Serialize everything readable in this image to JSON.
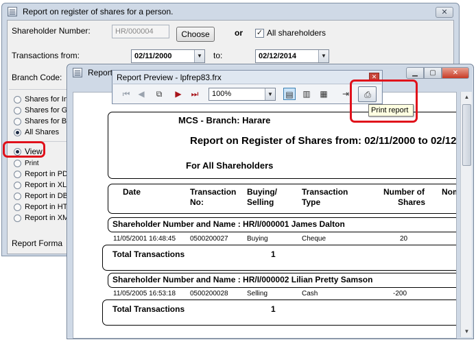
{
  "main_window": {
    "title": "Report on register of shares for a person.",
    "close_glyph": "✕",
    "shareholder_number_label": "Shareholder Number:",
    "shareholder_number_value": "HR/000004",
    "choose_label": "Choose",
    "or_label": "or",
    "all_shareholders_label": "All shareholders",
    "all_shareholders_checked": true,
    "transactions_from_label": "Transactions from:",
    "from_date": "02/11/2000",
    "to_label": "to:",
    "to_date": "02/12/2014",
    "branch_code_label": "Branch Code:",
    "report_format_label": "Report Forma",
    "radio_group_1": [
      {
        "label": "Shares for In",
        "selected": false
      },
      {
        "label": "Shares for G",
        "selected": false
      },
      {
        "label": "Shares for B",
        "selected": false
      },
      {
        "label": "All Shares",
        "selected": true
      }
    ],
    "radio_group_2": [
      {
        "label": "View",
        "selected": true
      },
      {
        "label": "Print",
        "selected": false
      },
      {
        "label": "Report in PDF",
        "selected": false
      },
      {
        "label": "Report in XLS",
        "selected": false
      },
      {
        "label": "Report in DBF",
        "selected": false
      },
      {
        "label": "Report in HTM",
        "selected": false
      },
      {
        "label": "Report in XML",
        "selected": false
      }
    ]
  },
  "report_window": {
    "title": "Report"
  },
  "preview_toolbar": {
    "title": "Report Preview - lpfrep83.frx",
    "zoom": "100%",
    "tooltip": "Print report"
  },
  "report": {
    "header_line1": "MCS - Branch: Harare",
    "header_line2": "Report on Register of Shares from:  02/11/2000 to 02/12",
    "header_line3": "For All Shareholders",
    "columns": {
      "date": "Date",
      "transaction_no_1": "Transaction",
      "transaction_no_2": "No:",
      "buying_selling_1": "Buying/",
      "buying_selling_2": "Selling",
      "transaction_type_1": "Transaction",
      "transaction_type_2": "Type",
      "number_shares_1": "Number of",
      "number_shares_2": "Shares",
      "nominal": "Nom"
    },
    "groups": [
      {
        "heading": "Shareholder Number and Name : HR/I/000001    James  Dalton",
        "row": {
          "date": "11/05/2001 16:48:45",
          "txn": "0500200027",
          "buy_sell": "Buying",
          "type": "Cheque",
          "shares": "20"
        },
        "total_label": "Total Transactions",
        "total_value": "1"
      },
      {
        "heading": "Shareholder Number and Name : HR/I/000002    Lilian Pretty Samson",
        "row": {
          "date": "11/05/2005 16:53:18",
          "txn": "0500200028",
          "buy_sell": "Selling",
          "type": "Cash",
          "shares": "-200"
        },
        "total_label": "Total Transactions",
        "total_value": "1"
      }
    ]
  },
  "colors": {
    "highlight": "#e0101a",
    "window_frame": "#cfd9e6"
  }
}
